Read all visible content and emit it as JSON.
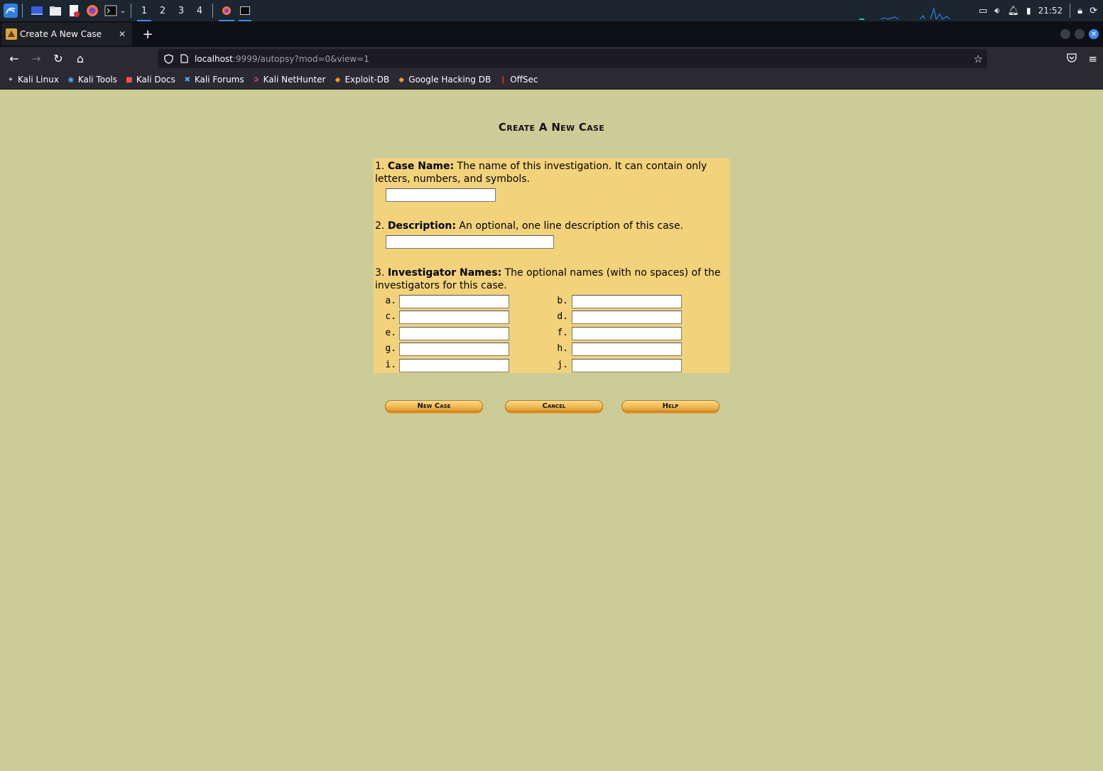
{
  "taskbar": {
    "workspaces": [
      "1",
      "2",
      "3",
      "4"
    ],
    "active_workspace": "1",
    "clock": "21:52"
  },
  "browser": {
    "tab_title": "Create A New Case",
    "url_host": "localhost",
    "url_rest": ":9999/autopsy?mod=0&view=1",
    "bookmarks": [
      "Kali Linux",
      "Kali Tools",
      "Kali Docs",
      "Kali Forums",
      "Kali NetHunter",
      "Exploit-DB",
      "Google Hacking DB",
      "OffSec"
    ]
  },
  "page": {
    "title": "Create A New Case",
    "case_name": {
      "number": "1.",
      "label": "Case Name:",
      "description": "The name of this investigation. It can contain only letters, numbers, and symbols.",
      "value": ""
    },
    "description_field": {
      "number": "2.",
      "label": "Description:",
      "description": "An optional, one line description of this case.",
      "value": ""
    },
    "investigators": {
      "number": "3.",
      "label": "Investigator Names:",
      "description": "The optional names (with no spaces) of the investigators for this case.",
      "fields": [
        {
          "label": "a.",
          "value": ""
        },
        {
          "label": "b.",
          "value": ""
        },
        {
          "label": "c.",
          "value": ""
        },
        {
          "label": "d.",
          "value": ""
        },
        {
          "label": "e.",
          "value": ""
        },
        {
          "label": "f.",
          "value": ""
        },
        {
          "label": "g.",
          "value": ""
        },
        {
          "label": "h.",
          "value": ""
        },
        {
          "label": "i.",
          "value": ""
        },
        {
          "label": "j.",
          "value": ""
        }
      ]
    },
    "buttons": {
      "new_case": "New Case",
      "cancel": "Cancel",
      "help": "Help"
    }
  },
  "colors": {
    "page_bg": "#cccc99",
    "form_bg": "#f3d27c",
    "button": "#f1b84e"
  }
}
